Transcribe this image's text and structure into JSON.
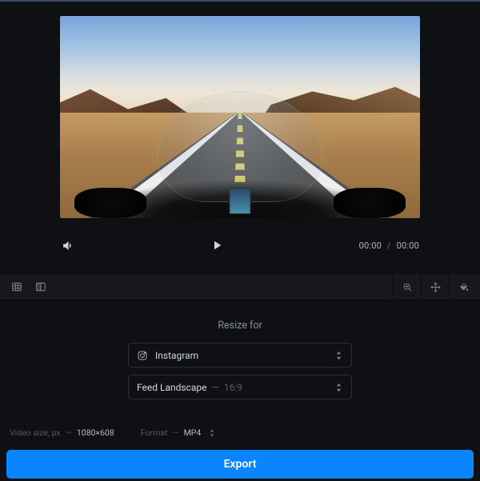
{
  "player": {
    "current_time": "00:00",
    "total_time": "00:00",
    "time_separator": "/"
  },
  "panel": {
    "title": "Resize for",
    "platform": {
      "label": "Instagram"
    },
    "preset": {
      "label": "Feed Landscape",
      "ratio_prefix": "—",
      "ratio": "16:9"
    }
  },
  "meta": {
    "size_label": "Video size, px",
    "size_sep": "—",
    "size_value": "1080×608",
    "format_label": "Format",
    "format_sep": "—",
    "format_value": "MP4"
  },
  "actions": {
    "export_label": "Export"
  },
  "colors": {
    "accent": "#0a84ff"
  }
}
